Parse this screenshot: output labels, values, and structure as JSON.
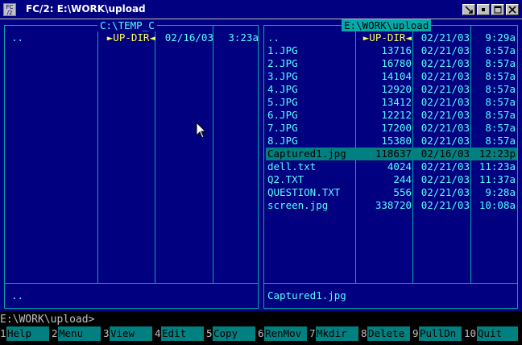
{
  "window": {
    "title": "FC/2: E:\\WORK\\upload",
    "icon_label_top": "FC",
    "icon_label_bottom": "/2"
  },
  "left_panel": {
    "title": "C:\\TEMP_C",
    "files": [
      {
        "name": "..",
        "size": "►UP-DIR◄",
        "date": "02/16/03",
        "time": "3:23a"
      }
    ],
    "status": ".."
  },
  "right_panel": {
    "title": "E:\\WORK\\upload",
    "files": [
      {
        "name": "..",
        "size": "►UP-DIR◄",
        "date": "02/21/03",
        "time": "9:29a"
      },
      {
        "name": "1.JPG",
        "size": "13716",
        "date": "02/21/03",
        "time": "8:57a"
      },
      {
        "name": "2.JPG",
        "size": "16780",
        "date": "02/21/03",
        "time": "8:57a"
      },
      {
        "name": "3.JPG",
        "size": "14104",
        "date": "02/21/03",
        "time": "8:57a"
      },
      {
        "name": "4.JPG",
        "size": "12920",
        "date": "02/21/03",
        "time": "8:57a"
      },
      {
        "name": "5.JPG",
        "size": "13412",
        "date": "02/21/03",
        "time": "8:57a"
      },
      {
        "name": "6.JPG",
        "size": "12212",
        "date": "02/21/03",
        "time": "8:57a"
      },
      {
        "name": "7.JPG",
        "size": "17200",
        "date": "02/21/03",
        "time": "8:57a"
      },
      {
        "name": "8.JPG",
        "size": "15380",
        "date": "02/21/03",
        "time": "8:57a"
      },
      {
        "name": "Captured1.jpg",
        "size": "118637",
        "date": "02/16/03",
        "time": "12:23p",
        "selected": true
      },
      {
        "name": "dell.txt",
        "size": "4024",
        "date": "02/21/03",
        "time": "11:23a"
      },
      {
        "name": "Q2.TXT",
        "size": "244",
        "date": "02/21/03",
        "time": "11:37a"
      },
      {
        "name": "QUESTION.TXT",
        "size": "556",
        "date": "02/21/03",
        "time": "9:28a"
      },
      {
        "name": "screen.jpg",
        "size": "338720",
        "date": "02/21/03",
        "time": "10:08a"
      }
    ],
    "status": "Captured1.jpg"
  },
  "command_line": "E:\\WORK\\upload>",
  "keybar": [
    {
      "num": "1",
      "label": "Help"
    },
    {
      "num": "2",
      "label": "Menu"
    },
    {
      "num": "3",
      "label": "View"
    },
    {
      "num": "4",
      "label": "Edit"
    },
    {
      "num": "5",
      "label": "Copy"
    },
    {
      "num": "6",
      "label": "RenMov"
    },
    {
      "num": "7",
      "label": "Mkdir"
    },
    {
      "num": "8",
      "label": "Delete"
    },
    {
      "num": "9",
      "label": "PullDn"
    },
    {
      "num": "10",
      "label": "Quit"
    }
  ],
  "colors": {
    "panel_bg": "#000080",
    "border": "#00aaaa",
    "text": "#55ffff",
    "updir": "#ffff55",
    "selection_bg": "#008080",
    "keybar_label_bg": "#008080"
  }
}
